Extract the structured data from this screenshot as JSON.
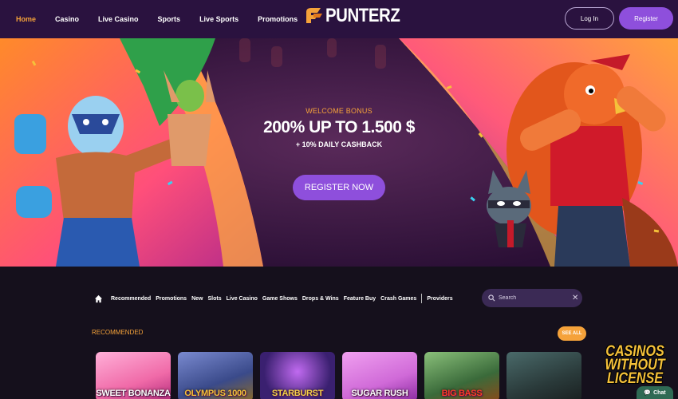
{
  "nav": {
    "links": [
      {
        "label": "Home",
        "active": true
      },
      {
        "label": "Casino",
        "active": false
      },
      {
        "label": "Live Casino",
        "active": false
      },
      {
        "label": "Sports",
        "active": false
      },
      {
        "label": "Live Sports",
        "active": false
      },
      {
        "label": "Promotions",
        "active": false
      }
    ],
    "logo_text": "PUNTERZ",
    "login_label": "Log In",
    "register_label": "Register"
  },
  "hero": {
    "bonus_label": "WELCOME BONUS",
    "headline": "200% UP TO 1.500 $",
    "subline": "+ 10% DAILY CASHBACK",
    "cta_label": "REGISTER NOW"
  },
  "categories": [
    "Recommended",
    "Promotions",
    "New",
    "Slots",
    "Live Casino",
    "Game Shows",
    "Drops & Wins",
    "Feature Buy",
    "Crash Games"
  ],
  "categories_extra": "Providers",
  "search": {
    "placeholder": "Search"
  },
  "section": {
    "title": "RECOMMENDED",
    "see_all_label": "SEE ALL"
  },
  "games": [
    {
      "title": "SWEET BONANZA",
      "color": "#f06aa8"
    },
    {
      "title": "OLYMPUS 1000",
      "color": "#3a4a8a"
    },
    {
      "title": "STARBURST",
      "color": "#3a2070"
    },
    {
      "title": "SUGAR RUSH",
      "color": "#d06ad8"
    },
    {
      "title": "BIG BASS",
      "color": "#3a6a3a"
    },
    {
      "title": "",
      "color": "#2a3a3a"
    }
  ],
  "watermark_text": "CASINOS WITHOUT LICENSE",
  "chat_label": "Chat",
  "colors": {
    "accent_orange": "#f5a23a",
    "accent_purple": "#8e4fdc",
    "nav_bg": "#2a123f",
    "page_bg": "#15101c"
  }
}
